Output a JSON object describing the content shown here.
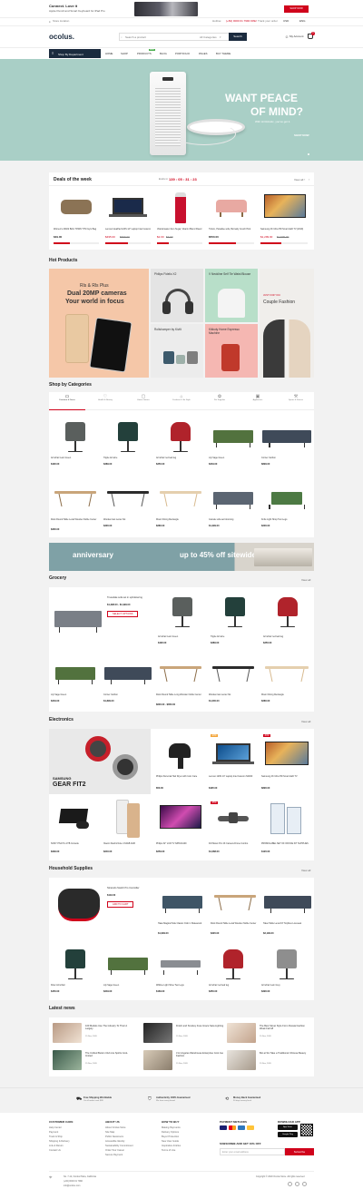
{
  "topbar": {
    "title": "Connect. Love it",
    "subtitle": "Apple Pencil and Smart Keyboard for iPad Pro",
    "cta": "SHOP NOW"
  },
  "infobar": {
    "location": "Store location",
    "hotline_prefix": "Hotline: ",
    "hotline": "(+84) 0000 01 7990 0092",
    "track": "Track your order",
    "currency": "USD",
    "language": "ENG"
  },
  "header": {
    "logo": "ocolus.",
    "search_placeholder": "Search a product",
    "category": "All Categories",
    "search_btn": "Search",
    "account": "My Account",
    "cart_count": "0"
  },
  "nav": {
    "dept": "Shop By Department",
    "items": [
      "HOME",
      "SHOP",
      "PRODUCTS",
      "BLOG",
      "PORTFOLIO",
      "PAGES",
      "BUY THEME"
    ],
    "badge": "NEW"
  },
  "hero": {
    "line1": "WANT PEACE",
    "line2": "OF MIND?",
    "sub": "With Hi Robotic, you've got it.",
    "cta": "SHOP NOW"
  },
  "deals": {
    "title": "Deals of the week",
    "timer_label": "Ends in",
    "timer": "139 : 05 : 31 : 23",
    "view_all": "View all",
    "items": [
      {
        "name": "Women's 20022 BAG TOWN TYM Gym Bag",
        "price": "$49.00",
        "old": "",
        "sold": 0.35
      },
      {
        "name": "Lenovo IdeaPad 120S 14\" Laptop Intel Celeron",
        "price": "$495.00",
        "old": "$699.00",
        "sold": 0.5
      },
      {
        "name": "Vitaminwater Zero Sugar, Vitamin Blend Flavor",
        "price": "$2.00",
        "old": "$3.00",
        "sold": 0.25
      },
      {
        "name": "Tvilum, Paradise sofa, Burnaby Couch Pink",
        "price": "$550.00",
        "old": "",
        "sold": 0.6
      },
      {
        "name": "Samsung 4K Ultra HD Smart LED TV (2019)",
        "price": "$1,299.00",
        "old": "$1,599.00",
        "sold": 0.45
      }
    ]
  },
  "hot": {
    "title": "Hot Products",
    "b1_small": "Rls & Rls Plus",
    "b1_big1": "Dual 20MP cameras",
    "b1_big2": "Your world in focus",
    "b2": "Philips Fidelio X2",
    "b3": "V Neckline Self Tie Waist Blouse",
    "b4": "Rollshomper by Kivilt",
    "b5": "Kikkuty Home Espresso Machine",
    "b6_small": "JUST FOR YOU",
    "b6": "Couple Fashion"
  },
  "cats": {
    "title": "Shop by Categories",
    "tabs": [
      "Furniture & Decor",
      "Health & Beauty",
      "Home Games",
      "Fashion & Life Style",
      "Pet Supplies",
      "Appliances",
      "Sports & Fitness"
    ],
    "items": [
      {
        "name": "Armchair Lam Green",
        "price": "$490.00"
      },
      {
        "name": "Tipple Armoire",
        "price": "$389.00"
      },
      {
        "name": "Armchair red leaf leg",
        "price": "$350.00"
      },
      {
        "name": "Lily Sage Green",
        "price": "$349.00"
      },
      {
        "name": "Corner Carbon",
        "price": "$899.00"
      },
      {
        "name": "Rock Round Table Lenal Wooden Noble Center",
        "price": "$300.00"
      },
      {
        "name": "Wooden last center fist",
        "price": "$300.00"
      },
      {
        "name": "Moon Dining Rectangle",
        "price": "$280.00"
      },
      {
        "name": "Grande sofa set blooming",
        "price": "$1,399.00"
      },
      {
        "name": "Knife Light Shop Two Legs",
        "price": "$200.00"
      }
    ]
  },
  "promo": {
    "left": "anniversary",
    "right": "up to 45% off sitewide"
  },
  "grocery": {
    "title": "Grocery",
    "view_all": "View all",
    "feat_name": "Truesdale sofa set in upholstering",
    "feat_price": "$1,398.00 - $1,999.00",
    "feat_btn": "SELECT OPTIONS",
    "items": [
      {
        "name": "Armchair Lam Green",
        "price": "$490.00"
      },
      {
        "name": "Tipple Armoire",
        "price": "$389.00"
      },
      {
        "name": "Armchair red leaf leg",
        "price": "$350.00"
      },
      {
        "name": "Lily Sage Green",
        "price": "$349.00"
      },
      {
        "name": "Corner Carbon",
        "price": "$1,899.00"
      },
      {
        "name": "Rock Round Table Long Wooden Noble Center",
        "price": "$600.00 - $850.00"
      },
      {
        "name": "Wooden last center fist",
        "price": "$1,200.00"
      },
      {
        "name": "Moon Dining Rectangle",
        "price": "$280.00"
      }
    ]
  },
  "electronics": {
    "title": "Electronics",
    "view_all": "View all",
    "banner1": "SAMSUNG",
    "banner2": "GEAR FIT2",
    "items": [
      {
        "name": "Philips Personal Hair Dryer with Ionic Care",
        "price": "$50.00",
        "tag": ""
      },
      {
        "name": "Lenovo 120S 14\" Laptop Intel Celeron N4000",
        "price": "$495.00",
        "tag": "-20%"
      },
      {
        "name": "Samsung 4K Ultra HD Smart LED TV",
        "price": "$890.00",
        "tag": "-30%"
      },
      {
        "name": "SONY PS4 Pro 1TB Console",
        "price": "$299.00",
        "tag": ""
      },
      {
        "name": "Xiaomi Redmi Note 4 64GB 4GB",
        "price": "$240.00",
        "tag": ""
      },
      {
        "name": "Philips 32\" LCD TV 32PFA4100",
        "price": "$259.00",
        "tag": ""
      },
      {
        "name": "DJI Mavic Pro 4K Camera Drone Combo",
        "price": "$1,088.00",
        "tag": "-35%"
      },
      {
        "name": "PROMOLABEL SET OF OFFICE KIT SUPPLIES",
        "price": "$120.00",
        "tag": ""
      }
    ]
  },
  "household": {
    "title": "Household Supplies",
    "view_all": "View all",
    "feat_name": "Nintendo Switch Pro Controller",
    "feat_price": "$119.00",
    "feat_btn": "ADD TO CART",
    "items": [
      {
        "name": "Haas Magical Side Classic Club in Slatewood",
        "price": "$1,699.00"
      },
      {
        "name": "Rock Round Table Lenal Wooden Noble Center",
        "price": "$320.00"
      },
      {
        "name": "Takei Table Lenai F3 Trophies Loveseat",
        "price": "$2,199.00"
      },
      {
        "name": "Kitter Armchair",
        "price": "$450.00"
      },
      {
        "name": "Lily Sage Green",
        "price": "$349.00"
      },
      {
        "name": "Wilkine Light Shoe Two Legs",
        "price": "$169.00"
      },
      {
        "name": "Armchair red leaf leg",
        "price": "$350.00"
      },
      {
        "name": "Armchair Lam Grey",
        "price": "$390.00"
      }
    ]
  },
  "news": {
    "title": "Latest news",
    "items": [
      {
        "title": "100 Models Use The Industry To Their A Largely",
        "date": "15 Nov, 2020"
      },
      {
        "title": "Finish and Smokey Fuse Grace Sata Lighting",
        "date": "15 Nov, 2020"
      },
      {
        "title": "The Best Street Style From Russia Fashion Week Fall 18",
        "date": "15 Nov, 2020"
      },
      {
        "title": "The Unified Button Club Are Spirits Cool-Innited",
        "date": "15 Nov, 2020"
      },
      {
        "title": "3 Ar Angeles Warehouse Enterprise Cool Joe Fashion",
        "date": "15 Nov, 2020"
      },
      {
        "title": "Bot at Six Take a Traditional Chinese Beauty",
        "date": "15 Nov, 2020"
      }
    ]
  },
  "features": [
    {
      "title": "Free Shipping Worldwide",
      "sub": "On all orders over $99"
    },
    {
      "title": "Authenticity 100% Guaranteed",
      "sub": "We have every brand"
    },
    {
      "title": "Money Back Guaranteed",
      "sub": "30 days money back"
    }
  ],
  "footer": {
    "cols": [
      {
        "h": "CUSTOMER CARE",
        "items": [
          "Help Center",
          "Payment",
          "Track & Ship",
          "Shipping & Delivery",
          "Link & Return",
          "Contact Us"
        ]
      },
      {
        "h": "ABOUT US",
        "items": [
          "About Ocolus Store",
          "Site Map",
          "Public Newsroom",
          "Accessible Identity",
          "Sustainability Commitment",
          "Order Tour Career",
          "Secure Payment"
        ]
      },
      {
        "h": "HOW TO BUY",
        "items": [
          "Making Payments",
          "Delivery Options",
          "Buyer Protection",
          "New User Guide",
          "Inspiration Articles",
          "Terms of Use"
        ]
      }
    ],
    "pay_title": "PAYMENT METHODS",
    "sub_title": "SUBSCRIBE AND GET 10% OFF",
    "email_placeholder": "Enter your email address",
    "subscribe": "Subscribe",
    "download": "DOWNLOAD APP",
    "app1": "App Store",
    "app2": "Google Play",
    "address": "No. 7-12, Ocolus Plaza, California",
    "phone": "(+84) 0000 01 7990",
    "email": "info@ocolus.com",
    "copyright": "Copyright © 2020 Ocolus Store. All rights reserved"
  },
  "colors": {
    "accent": "#d0021b",
    "hero_bg": "#a9cfc6",
    "nav_dark": "#1b2b3e"
  }
}
